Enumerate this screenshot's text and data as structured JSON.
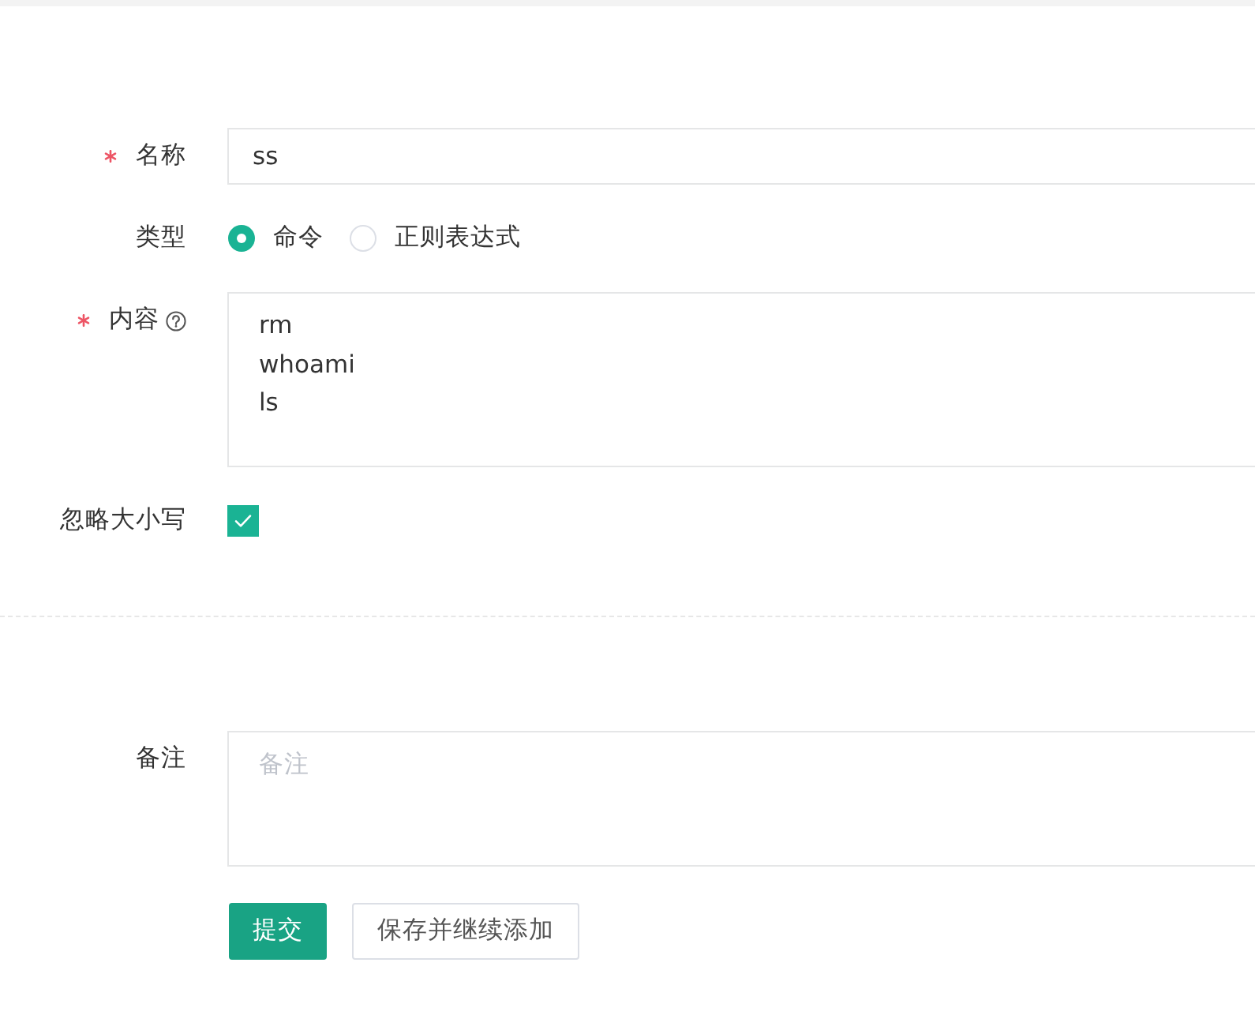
{
  "form": {
    "groups": [
      {
        "fields": [
          {
            "kind": "text",
            "label": "名称",
            "required": true,
            "value": "ss"
          },
          {
            "kind": "radio",
            "label": "类型",
            "options": [
              {
                "label": "命令",
                "selected": true
              },
              {
                "label": "正则表达式",
                "selected": false
              }
            ]
          },
          {
            "kind": "textarea",
            "label": "内容",
            "required": true,
            "help": true,
            "value": "rm\nwhoami\nls"
          },
          {
            "kind": "checkbox",
            "label": "忽略大小写",
            "checked": true
          }
        ]
      },
      {
        "fields": [
          {
            "kind": "textarea",
            "label": "备注",
            "placeholder": "备注"
          }
        ]
      }
    ],
    "buttons": [
      {
        "kind": "primary",
        "label": "提交"
      },
      {
        "kind": "default",
        "label": "保存并继续添加"
      }
    ]
  }
}
